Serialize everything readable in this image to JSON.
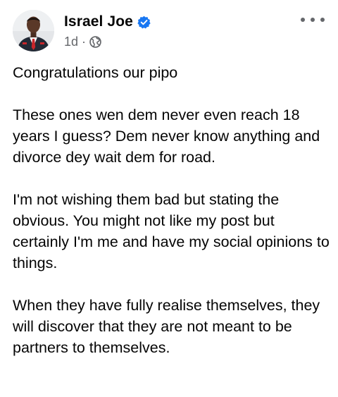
{
  "post": {
    "author": "Israel Joe",
    "verified": true,
    "timestamp": "1d",
    "separator": "·",
    "audience_icon": "globe-icon",
    "more_icon": "more-options-icon",
    "paragraphs": [
      "Congratulations our pipo",
      "These ones wen dem never even reach 18 years I guess? Dem never know anything and divorce dey wait dem for road.",
      "I'm not wishing them bad but stating the obvious. You might not like my post but certainly I'm me and have my social opinions to things.",
      "When they have fully realise themselves, they will discover that they are not meant to be partners to themselves."
    ]
  },
  "colors": {
    "verified_blue": "#1877f2",
    "secondary_text": "#65676b",
    "primary_text": "#050505"
  }
}
